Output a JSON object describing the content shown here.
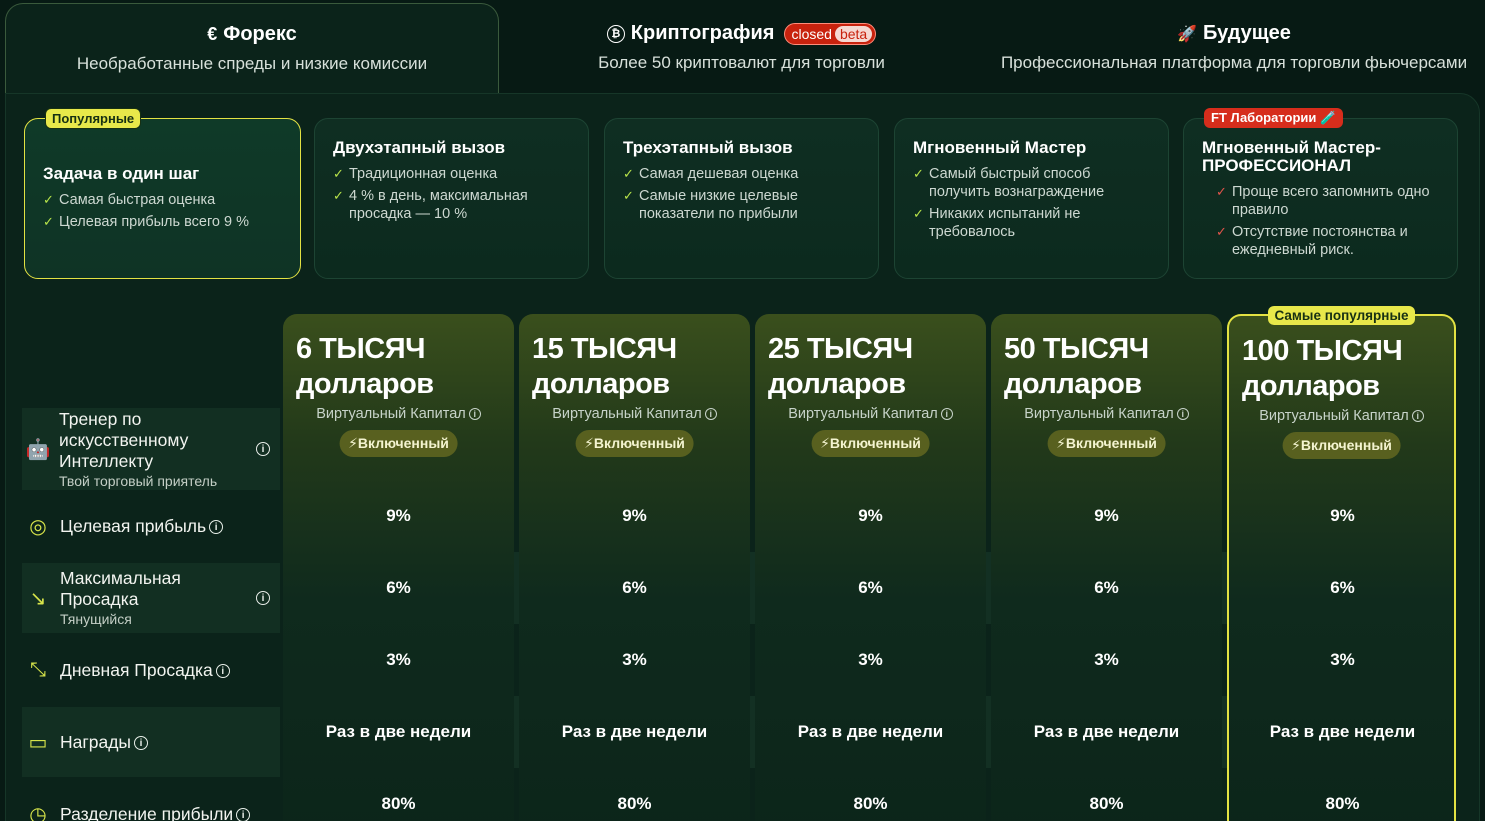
{
  "tabs": [
    {
      "icon": "€",
      "title": "Форекс",
      "subtitle": "Необработанные спреды и низкие комиссии"
    },
    {
      "icon": "₿",
      "title": "Криптография",
      "badge_closed": "closed",
      "badge_beta": "beta",
      "subtitle": "Более 50 криптовалют для торговли"
    },
    {
      "icon": "🚀",
      "title": "Будущее",
      "subtitle": "Профессиональная платформа для торговли фьючерсами"
    }
  ],
  "plans": [
    {
      "badge": "Популярные",
      "title": "Задача в один шаг",
      "features": [
        "Самая быстрая оценка",
        "Целевая прибыль всего 9 %"
      ]
    },
    {
      "title": "Двухэтапный вызов",
      "features": [
        "Традиционная оценка",
        "4 % в день, максимальная просадка — 10 %"
      ]
    },
    {
      "title": "Трехэтапный вызов",
      "features": [
        "Самая дешевая оценка",
        "Самые низкие целевые показатели по прибыли"
      ]
    },
    {
      "title": "Мгновенный Мастер",
      "features": [
        "Самый быстрый способ получить вознаграждение",
        "Никаких испытаний не требовалось"
      ]
    },
    {
      "badge": "FT Лаборатории 🧪",
      "title": "Мгновенный Мастер-ПРОФЕССИОНАЛ",
      "features": [
        "Проще всего запомнить одно правило",
        "Отсутствие постоянства и ежедневный риск."
      ]
    }
  ],
  "rows": {
    "ai_coach": {
      "title": "Тренер по искусственному Интеллекту",
      "sub": "Твой торговый приятель"
    },
    "target": {
      "title": "Целевая прибыль"
    },
    "max_dd": {
      "title": "Максимальная Просадка",
      "sub": "Тянущийся"
    },
    "daily_dd": {
      "title": "Дневная Просадка"
    },
    "rewards": {
      "title": "Награды"
    },
    "split": {
      "title": "Разделение прибыли"
    }
  },
  "capital_label": "Виртуальный Капитал",
  "included_label": "⚡Включенный",
  "popular_label": "Самые популярные",
  "columns": [
    {
      "line1": "6 ТЫСЯЧ",
      "line2": "долларов",
      "target": "9%",
      "max_dd": "6%",
      "daily_dd": "3%",
      "rewards": "Раз в две недели",
      "split": "80%"
    },
    {
      "line1": "15 ТЫСЯЧ",
      "line2": "долларов",
      "target": "9%",
      "max_dd": "6%",
      "daily_dd": "3%",
      "rewards": "Раз в две недели",
      "split": "80%"
    },
    {
      "line1": "25 ТЫСЯЧ",
      "line2": "долларов",
      "target": "9%",
      "max_dd": "6%",
      "daily_dd": "3%",
      "rewards": "Раз в две недели",
      "split": "80%"
    },
    {
      "line1": "50 ТЫСЯЧ",
      "line2": "долларов",
      "target": "9%",
      "max_dd": "6%",
      "daily_dd": "3%",
      "rewards": "Раз в две недели",
      "split": "80%"
    },
    {
      "line1": "100 ТЫСЯЧ",
      "line2": "долларов",
      "target": "9%",
      "max_dd": "6%",
      "daily_dd": "3%",
      "rewards": "Раз в две недели",
      "split": "80%"
    }
  ],
  "colors": {
    "accent": "#e3e243",
    "background": "#071a14",
    "lab_badge": "#d62d1c"
  }
}
